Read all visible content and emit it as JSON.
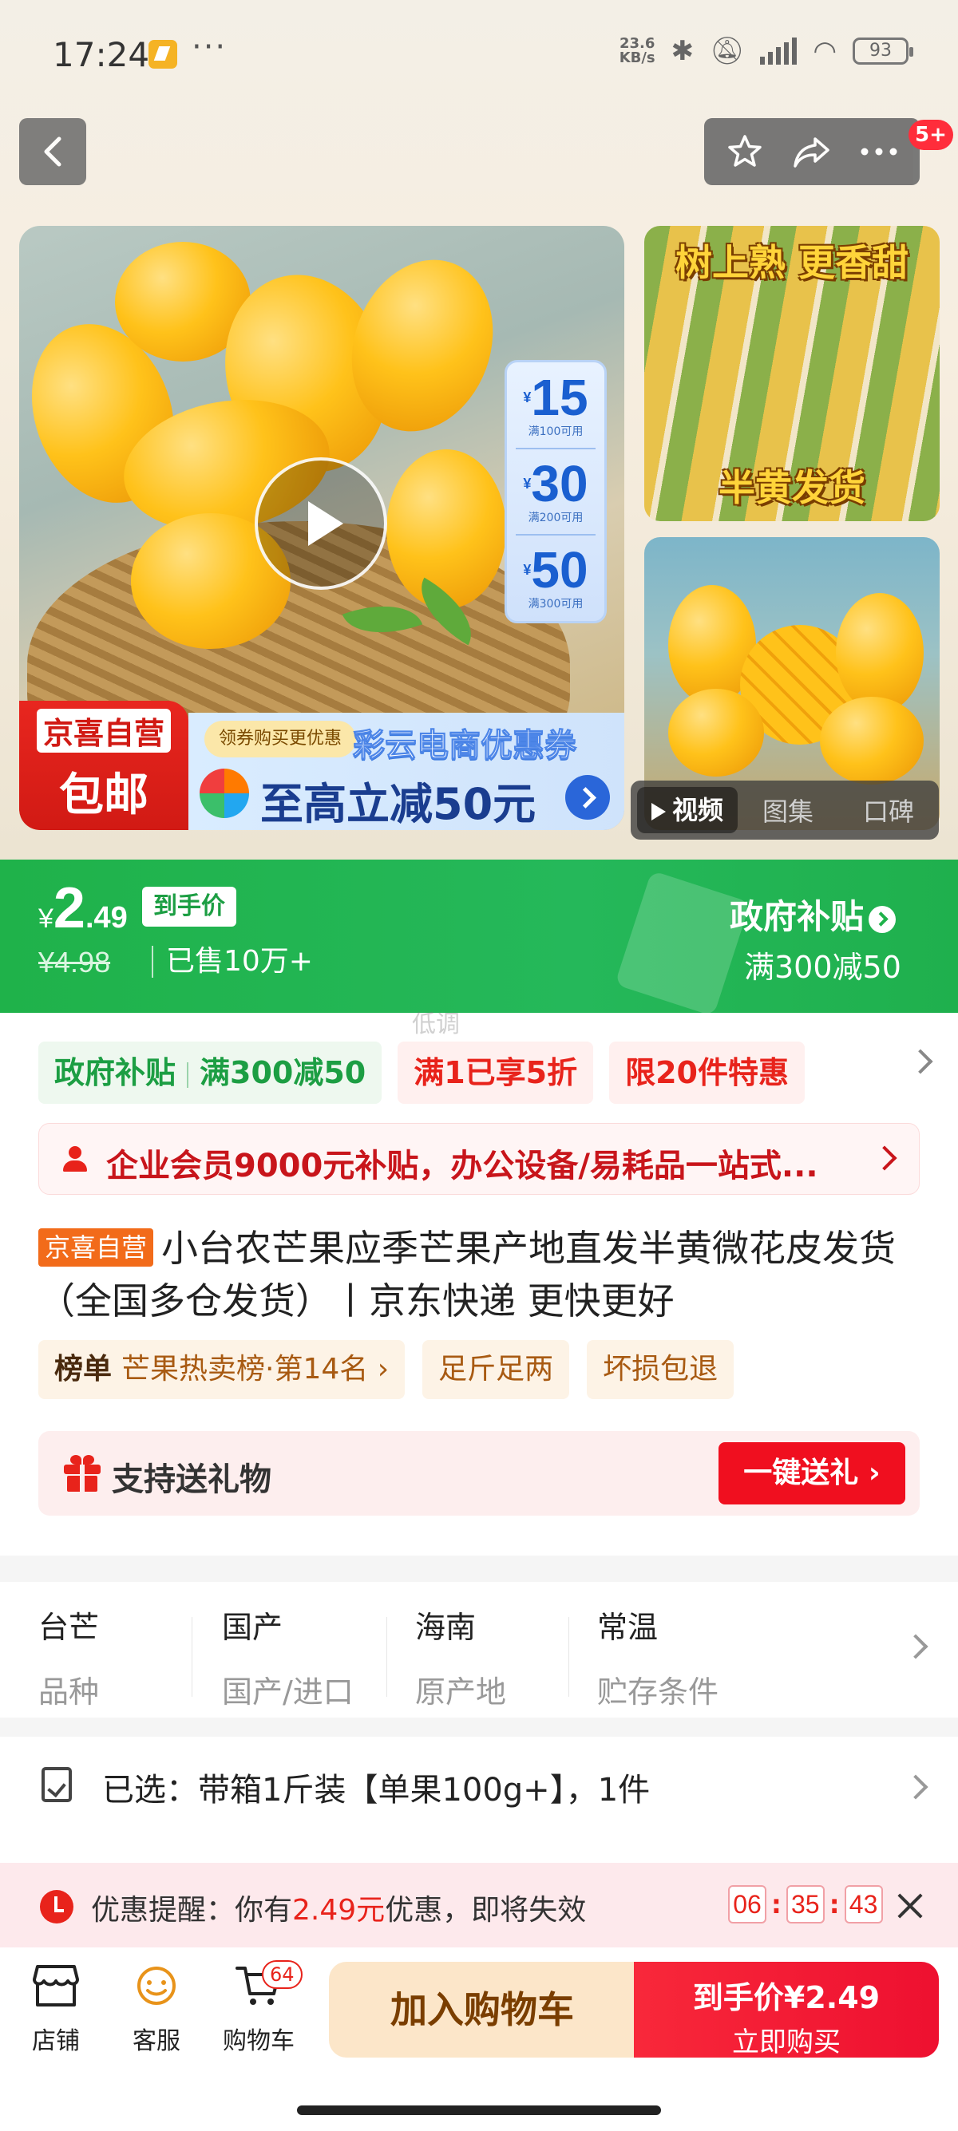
{
  "status_bar": {
    "time": "17:24",
    "dots": "···",
    "speed": "23.6\nKB/s",
    "battery": "93"
  },
  "nav": {
    "badge": "5+"
  },
  "media": {
    "coupons": [
      {
        "currency": "¥",
        "amount": "15",
        "condition": "满100可用"
      },
      {
        "currency": "¥",
        "amount": "30",
        "condition": "满200可用"
      },
      {
        "currency": "¥",
        "amount": "50",
        "condition": "满300可用"
      }
    ],
    "promo_left_l1": "京喜自营",
    "promo_left_l2": "包邮",
    "promo_chip": "领券购买更优惠",
    "promo_title": "彩云电商优惠券",
    "promo_main": "至高立减50元",
    "thumb1_top": "树上熟 更香甜",
    "thumb1_bottom": "半黄发货",
    "tabs": [
      "视频",
      "图集",
      "口碑"
    ]
  },
  "price": {
    "currency": "¥",
    "integer": "2",
    "decimal": ".49",
    "label": "到手价",
    "original": "¥4.98",
    "sold": "已售10万+",
    "subsidy_title": "政府补贴",
    "subsidy_sub": "满300减50"
  },
  "watermark": "低调",
  "tags": {
    "green_a": "政府补贴",
    "green_b": "满300减50",
    "red_1": "满1已享5折",
    "red_2": "限20件特惠"
  },
  "member_banner": "企业会员9000元补贴，办公设备/易耗品一站式...",
  "product": {
    "badge": "京喜自营",
    "title": "小台农芒果应季芒果产地直发半黄微花皮发货（全国多仓发货）丨京东快递 更快更好"
  },
  "chips": {
    "rank_label": "榜单",
    "rank_value": "芒果热卖榜·第14名",
    "chip2": "足斤足两",
    "chip3": "坏损包退"
  },
  "gift": {
    "text": "支持送礼物",
    "button": "一键送礼"
  },
  "specs": [
    {
      "value": "台芒",
      "key": "品种"
    },
    {
      "value": "国产",
      "key": "国产/进口"
    },
    {
      "value": "海南",
      "key": "原产地"
    },
    {
      "value": "常温",
      "key": "贮存条件"
    }
  ],
  "selected": "已选：带箱1斤装【单果100g+】，1件",
  "reminder": {
    "prefix": "优惠提醒：你有",
    "amount": "2.49元",
    "suffix": "优惠，即将失效",
    "hh": "06",
    "mm": "35",
    "ss": "43",
    "sep": ":"
  },
  "bottom": {
    "shop": "店铺",
    "service": "客服",
    "cart": "购物车",
    "cart_count": "64",
    "add_cart": "加入购物车",
    "buy_price": "到手价¥2.49",
    "buy_now": "立即购买"
  },
  "colors": {
    "brand_green": "#1fb24a",
    "accent_red": "#e8231b",
    "buy_red": "#f8283a"
  }
}
